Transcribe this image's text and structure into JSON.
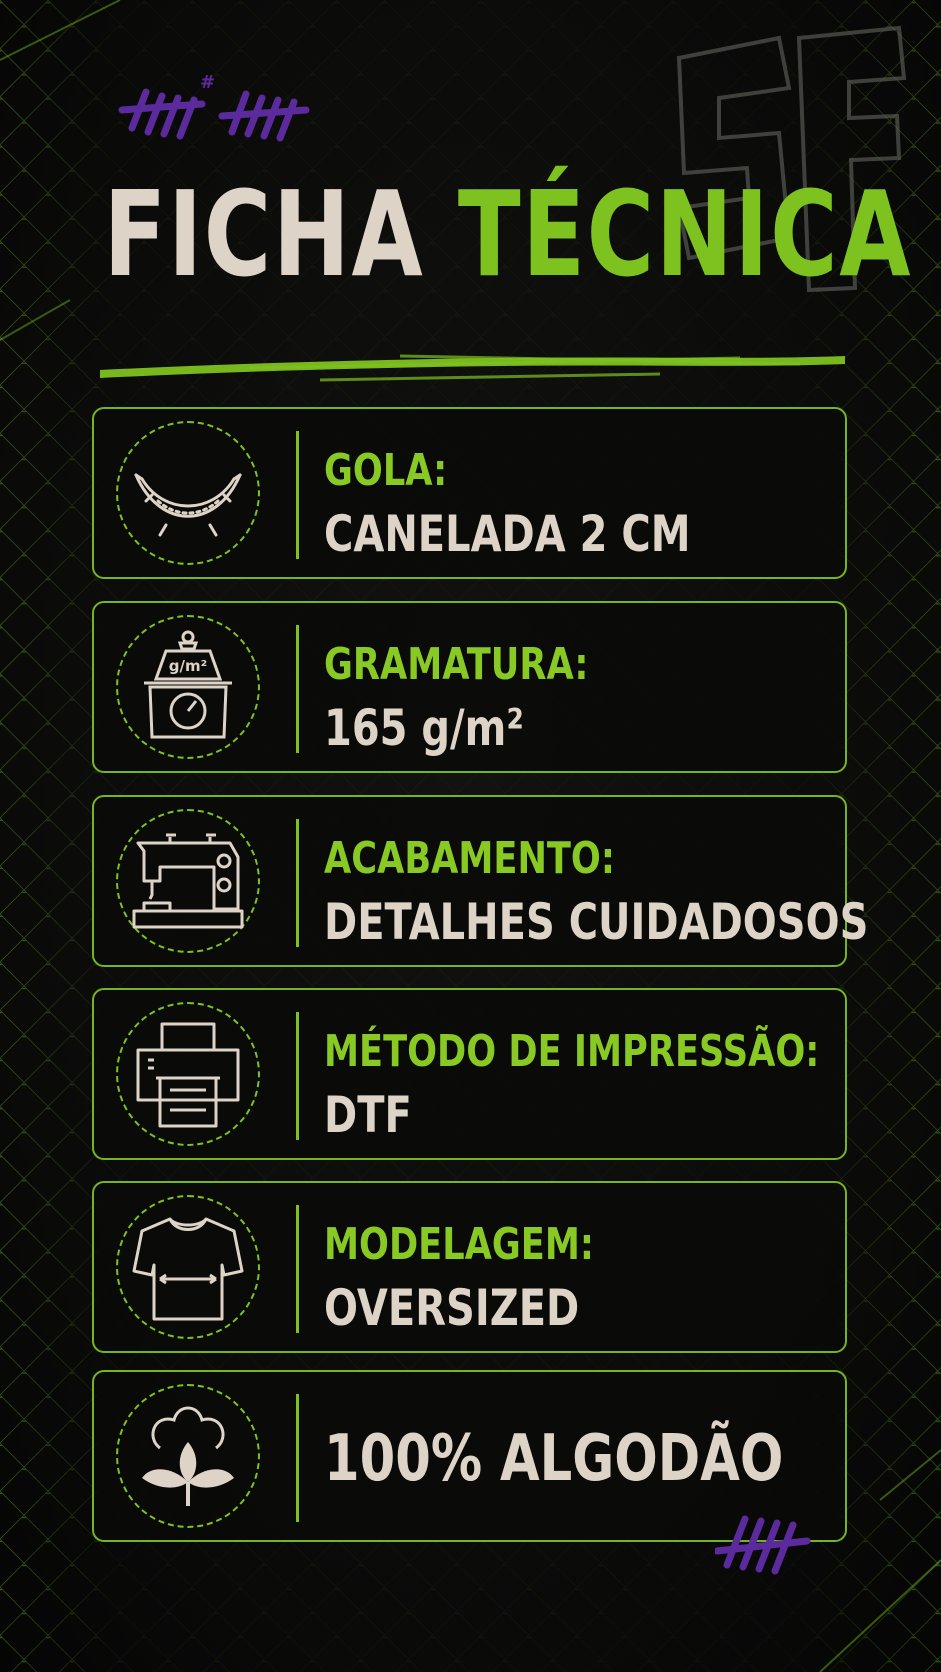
{
  "title": {
    "word1": "FICHA",
    "word2": "TÉCNICA"
  },
  "colors": {
    "accent_green": "#7ec21f",
    "text_cream": "#ddd3c6",
    "tally_purple": "#5a2a9a",
    "background": "#0b0b0a"
  },
  "specs": [
    {
      "icon": "collar-icon",
      "label": "GOLA:",
      "value": "CANELADA 2 CM"
    },
    {
      "icon": "scale-icon",
      "label": "GRAMATURA:",
      "value": "165 g/m²",
      "icon_text": "g/m²"
    },
    {
      "icon": "sewing-machine-icon",
      "label": "ACABAMENTO:",
      "value": "DETALHES CUIDADOSOS"
    },
    {
      "icon": "printer-icon",
      "label": "MÉTODO DE IMPRESSÃO:",
      "value": "DTF"
    },
    {
      "icon": "tshirt-icon",
      "label": "MODELAGEM:",
      "value": "OVERSIZED"
    },
    {
      "icon": "cotton-icon",
      "label": "",
      "value": "100% ALGODÃO"
    }
  ]
}
